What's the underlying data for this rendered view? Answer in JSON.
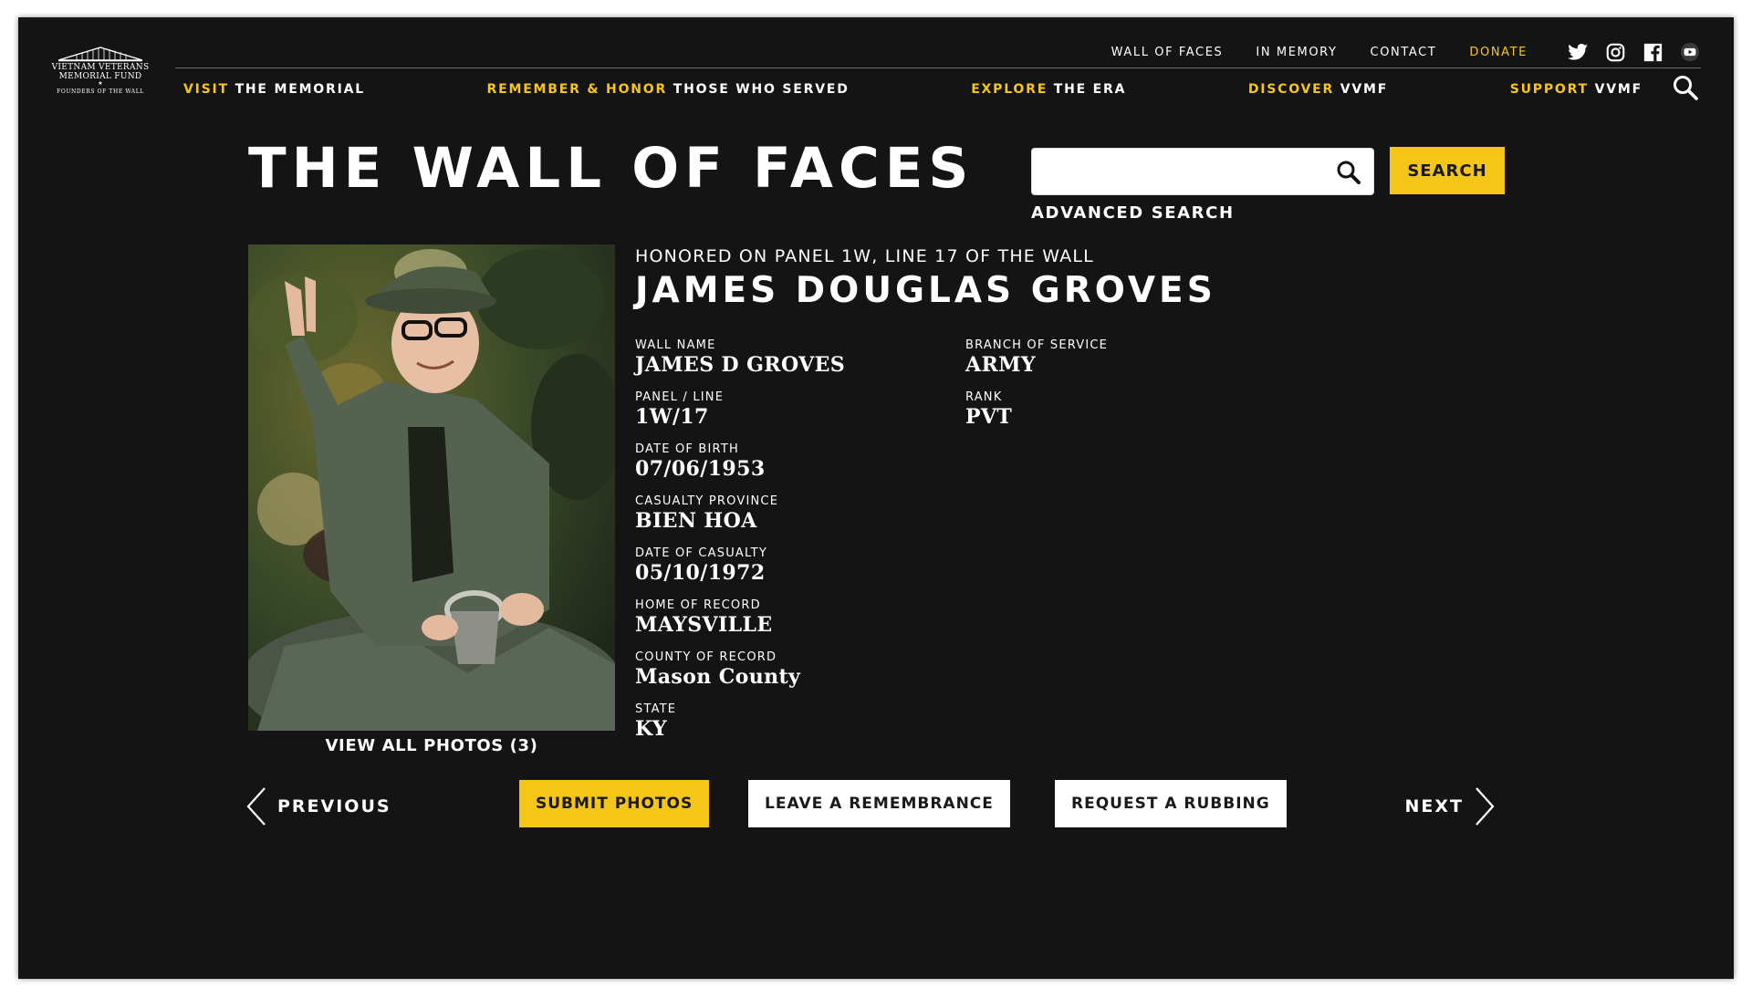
{
  "logo": {
    "line1": "VIETNAM VETERANS",
    "line2": "MEMORIAL FUND",
    "line3": "FOUNDERS OF THE WALL"
  },
  "utility_nav": [
    {
      "label": "WALL OF FACES"
    },
    {
      "label": "IN MEMORY"
    },
    {
      "label": "CONTACT"
    },
    {
      "label": "DONATE"
    }
  ],
  "social_icons": [
    "twitter-icon",
    "instagram-icon",
    "facebook-icon",
    "youtube-icon"
  ],
  "main_nav": [
    {
      "highlight": "VISIT",
      "rest": " THE MEMORIAL"
    },
    {
      "highlight": "REMEMBER & HONOR",
      "rest": " THOSE WHO SERVED"
    },
    {
      "highlight": "EXPLORE",
      "rest": " THE ERA"
    },
    {
      "highlight": "DISCOVER",
      "rest": " VVMF"
    },
    {
      "highlight": "SUPPORT",
      "rest": " VVMF"
    }
  ],
  "page": {
    "title": "THE WALL OF FACES",
    "search_value": "",
    "search_button": "SEARCH",
    "advanced_search": "ADVANCED SEARCH"
  },
  "profile": {
    "honored_line": "HONORED ON PANEL 1W, LINE 17 OF THE WALL",
    "full_name": "JAMES DOUGLAS GROVES",
    "view_photos": "VIEW ALL PHOTOS (3)",
    "fields": {
      "wall_name": {
        "label": "WALL NAME",
        "value": "JAMES D GROVES"
      },
      "branch": {
        "label": "BRANCH OF SERVICE",
        "value": "ARMY"
      },
      "panel_line": {
        "label": "PANEL / LINE",
        "value": "1W/17"
      },
      "rank": {
        "label": "RANK",
        "value": "PVT"
      },
      "dob": {
        "label": "DATE OF BIRTH",
        "value": "07/06/1953"
      },
      "province": {
        "label": "CASUALTY PROVINCE",
        "value": "BIEN HOA"
      },
      "casualty_date": {
        "label": "DATE OF CASUALTY",
        "value": "05/10/1972"
      },
      "home": {
        "label": "HOME OF RECORD",
        "value": "MAYSVILLE"
      },
      "county": {
        "label": "COUNTY OF RECORD",
        "value": "Mason County"
      },
      "state": {
        "label": "STATE",
        "value": "KY"
      }
    }
  },
  "actions": {
    "previous": "PREVIOUS",
    "submit_photos": "SUBMIT PHOTOS",
    "leave_remembrance": "LEAVE A REMEMBRANCE",
    "request_rubbing": "REQUEST A RUBBING",
    "next": "NEXT"
  },
  "colors": {
    "background": "#141414",
    "accent": "#f5c518",
    "text": "#ffffff"
  }
}
